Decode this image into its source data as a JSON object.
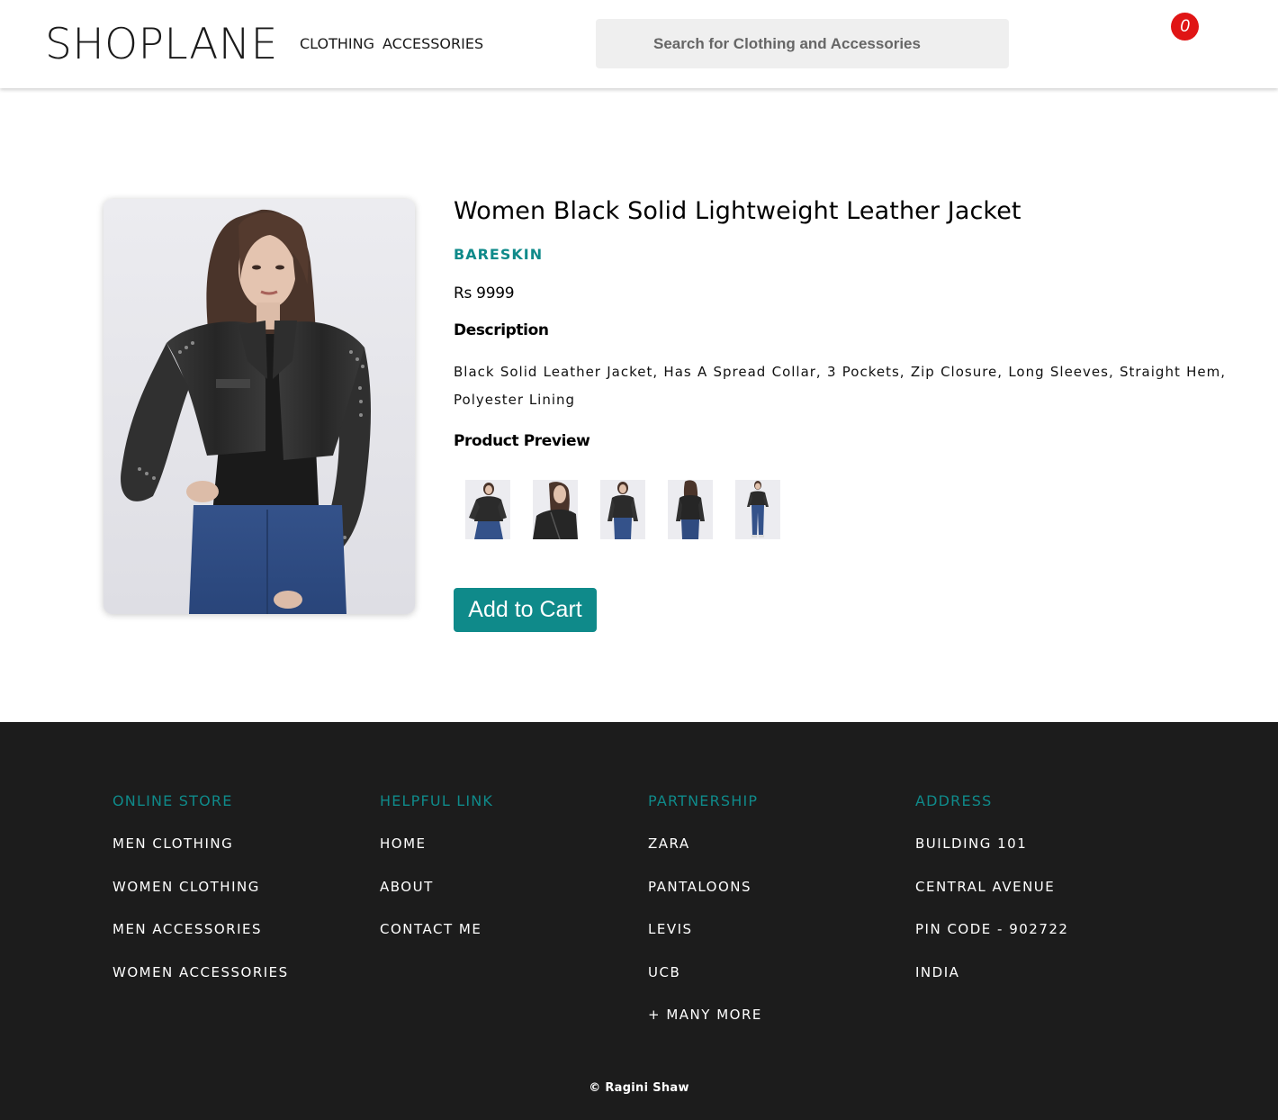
{
  "header": {
    "logo": "SHOPLANE",
    "nav": {
      "clothing": "CLOTHING",
      "accessories": "ACCESSORIES"
    },
    "search": {
      "placeholder": "Search for Clothing and Accessories",
      "value": ""
    },
    "cart": {
      "count": "0",
      "badge_color": "#e01515"
    }
  },
  "product": {
    "title": "Women Black Solid Lightweight Leather Jacket",
    "brand": "BARESKIN",
    "price": "Rs 9999",
    "description_heading": "Description",
    "description": "Black Solid Leather Jacket, Has A Spread Collar, 3 Pockets, Zip Closure, Long Sleeves, Straight Hem, Polyester Lining",
    "preview_heading": "Product Preview",
    "preview_count": 5,
    "add_to_cart_label": "Add to Cart",
    "accent_color": "#0f8a8a"
  },
  "footer": {
    "columns": [
      {
        "heading": "ONLINE STORE",
        "items": [
          "MEN CLOTHING",
          "WOMEN CLOTHING",
          "MEN ACCESSORIES",
          "WOMEN ACCESSORIES"
        ]
      },
      {
        "heading": "HELPFUL LINK",
        "items": [
          "HOME",
          "ABOUT",
          "CONTACT ME"
        ]
      },
      {
        "heading": "PARTNERSHIP",
        "items": [
          "ZARA",
          "PANTALOONS",
          "LEVIS",
          "UCB",
          "+ MANY MORE"
        ]
      },
      {
        "heading": "ADDRESS",
        "items": [
          "BUILDING 101",
          "CENTRAL AVENUE",
          "PIN CODE - 902722",
          "INDIA"
        ]
      }
    ],
    "copyright": "© Ragini Shaw",
    "background": "#1c1c1c"
  }
}
